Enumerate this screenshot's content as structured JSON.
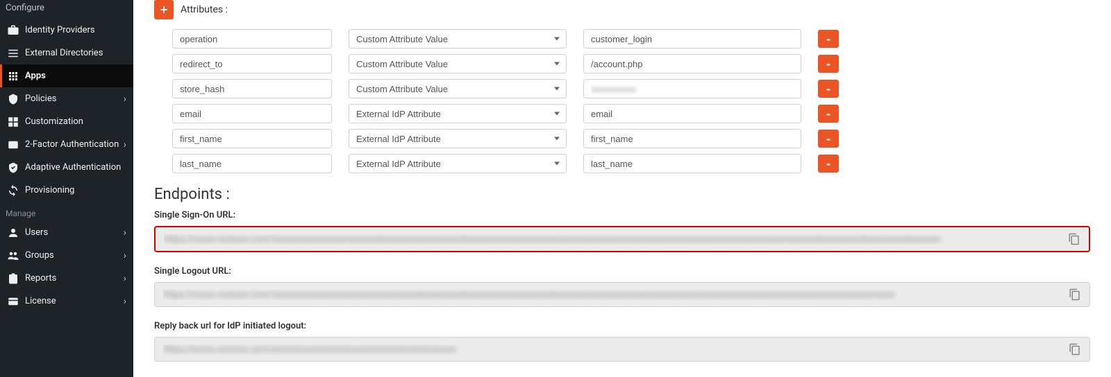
{
  "sidebar": {
    "section_configure": "Configure",
    "section_manage": "Manage",
    "items": [
      {
        "label": "Identity Providers",
        "icon": "idp"
      },
      {
        "label": "External Directories",
        "icon": "external-dir"
      },
      {
        "label": "Apps",
        "icon": "apps",
        "active": true
      },
      {
        "label": "Policies",
        "icon": "policies",
        "chevron": true
      },
      {
        "label": "Customization",
        "icon": "customization"
      },
      {
        "label": "2-Factor Authentication",
        "icon": "2fa",
        "chevron": true
      },
      {
        "label": "Adaptive Authentication",
        "icon": "adaptive"
      },
      {
        "label": "Provisioning",
        "icon": "provisioning"
      }
    ],
    "manage_items": [
      {
        "label": "Users",
        "icon": "users",
        "chevron": true
      },
      {
        "label": "Groups",
        "icon": "groups",
        "chevron": true
      },
      {
        "label": "Reports",
        "icon": "reports",
        "chevron": true
      },
      {
        "label": "License",
        "icon": "license",
        "chevron": true
      }
    ]
  },
  "attributes": {
    "title": "Attributes :",
    "rows": [
      {
        "name": "operation",
        "type": "Custom Attribute Value",
        "value": "customer_login"
      },
      {
        "name": "redirect_to",
        "type": "Custom Attribute Value",
        "value": "/account.php"
      },
      {
        "name": "store_hash",
        "type": "Custom Attribute Value",
        "value": "xxxxxxxxxx",
        "blurred": true
      },
      {
        "name": "email",
        "type": "External IdP Attribute",
        "value": "email"
      },
      {
        "name": "first_name",
        "type": "External IdP Attribute",
        "value": "first_name"
      },
      {
        "name": "last_name",
        "type": "External IdP Attribute",
        "value": "last_name"
      }
    ]
  },
  "endpoints": {
    "title": "Endpoints :",
    "sso_label": "Single Sign-On URL:",
    "sso_url": "https://xxxxx.xxxxxxx.com/xxxxxxxxxxxxxxxxxxxxxxxxxxxxxxxxxxxxxxxxxxxxxxxxxxxxxxxxxxxxxxxxxxxxxxxxxxxxxxxxxxxxxxxxxxxxxxxxxxxxxxxxxxxxxxxxxxxxxxxxxxxxxxxxxxxxxxxxxxxxxxxxxxxxx",
    "slo_label": "Single Logout URL:",
    "slo_url": "https://xxxxx.xxxxxxx.com/xxxxxxxxxxxxxxxxxxxxxxxxxxxxxxxxxxxxxxxxxxxxxxxxxxxxxxxxxxxxxxxxxxxxxxxxxxxxxxxxxxxxxxxxxxxxxxxxxxxxxxxxxxxxxxxxxxxxxxxxxxxxxxxxxxxxxxxxxxx",
    "reply_label": "Reply back url for IdP initiated logout:",
    "reply_url": "https://xxxxx.xxxxxxx.com/xxxxxxxxxxxxxxxxxxxxxxxxxxxxxxxxxxxxxxxxx"
  }
}
